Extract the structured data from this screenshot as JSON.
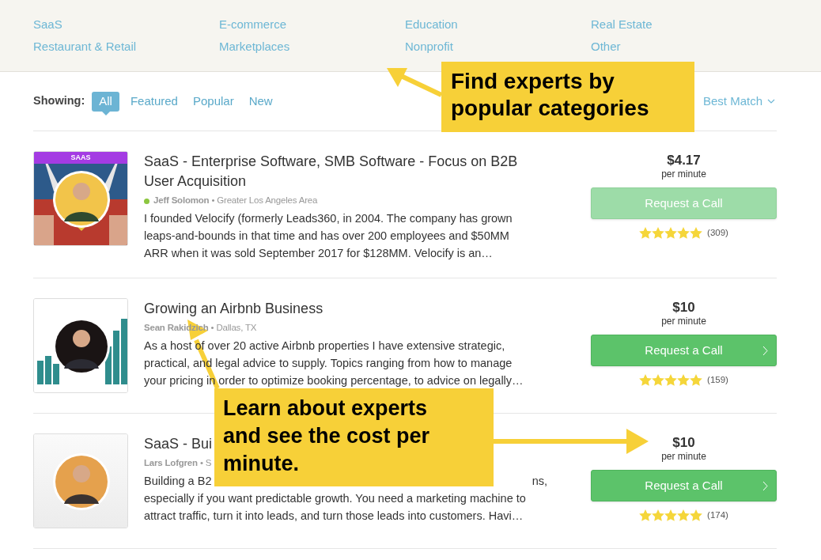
{
  "categories": [
    {
      "label": "SaaS"
    },
    {
      "label": "E-commerce"
    },
    {
      "label": "Education"
    },
    {
      "label": "Real Estate"
    },
    {
      "label": "Restaurant & Retail"
    },
    {
      "label": "Marketplaces"
    },
    {
      "label": "Nonprofit"
    },
    {
      "label": "Other"
    }
  ],
  "filter": {
    "label": "Showing:",
    "tabs": [
      {
        "label": "All",
        "selected": true
      },
      {
        "label": "Featured",
        "selected": false
      },
      {
        "label": "Popular",
        "selected": false
      },
      {
        "label": "New",
        "selected": false
      }
    ],
    "sort": "Best Match"
  },
  "experts": [
    {
      "badge": "SAAS",
      "title": "SaaS - Enterprise Software, SMB Software - Focus on B2B User Acquisition",
      "name": "Jeff Solomon",
      "online": true,
      "location": "• Greater Los Angeles Area",
      "description": [
        [
          "I founded Velocify (formerly Leads360, in 2004. The company has grown"
        ],
        [
          "leaps-and-bounds in that time and has over 200 employees and $50MM"
        ],
        [
          "ARR when it was sold September 2017 for $128MM. Velocify is an…"
        ]
      ],
      "price": "$4.17",
      "unit": "per minute",
      "button": "Request a Call",
      "disabled": true,
      "stars": 5,
      "reviews": "(309)"
    },
    {
      "title": "Growing an Airbnb Business",
      "name": "Sean Rakidzich",
      "online": false,
      "location": "• Dallas, TX",
      "description": [
        [
          "As a host of over 20 active Airbnb properties I have extensive strategic,"
        ],
        [
          "practical, and legal advice to supply. Topics ranging from how to manage"
        ],
        [
          "your pricing in order to optimize booking percentage, to advice on legally…"
        ]
      ],
      "price": "$10",
      "unit": "per minute",
      "button": "Request a Call",
      "disabled": false,
      "stars": 5,
      "reviews": "(159)"
    },
    {
      "title": "SaaS - Bui",
      "name": "Lars Lofgren",
      "online": false,
      "location": "• S",
      "description": [
        [
          "Building a B2",
          "ns,"
        ],
        [
          "especially if you want predictable growth. You need a marketing machine to"
        ],
        [
          "attract traffic, turn it into leads, and turn those leads into customers. Havi…"
        ]
      ],
      "price": "$10",
      "unit": "per minute",
      "button": "Request a Call",
      "disabled": false,
      "stars": 5,
      "reviews": "(174)"
    }
  ],
  "callouts": [
    {
      "text": "Find experts by popular categories"
    },
    {
      "text": "Learn about experts and see the cost per minute."
    }
  ]
}
